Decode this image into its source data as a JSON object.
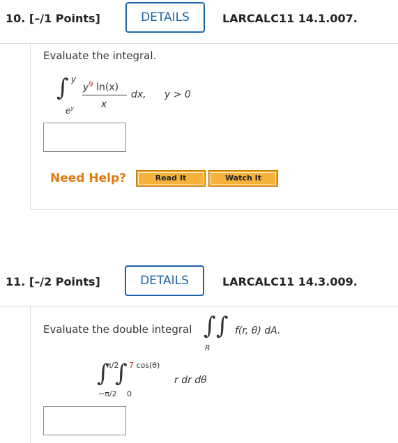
{
  "q10": {
    "number": "10.",
    "points": "[–/1 Points]",
    "details_label": "DETAILS",
    "code": "LARCALC11 14.1.007.",
    "prompt": "Evaluate the integral.",
    "integral": {
      "upper": "y",
      "lower": "e",
      "lower_sup": "y",
      "num_var": "y",
      "num_exp": "9",
      "num_rest": " ln(x)",
      "denominator": "x",
      "differential": "dx,",
      "condition": "y > 0"
    },
    "need_help": "Need Help?",
    "read_it": "Read It",
    "watch_it": "Watch It"
  },
  "q11": {
    "number": "11.",
    "points": "[–/2 Points]",
    "details_label": "DETAILS",
    "code": "LARCALC11 14.3.009.",
    "prompt": "Evaluate the double integral",
    "region": "R",
    "integrand": "f(r, θ) dA.",
    "outer_upper": "π/2",
    "outer_lower": "−π/2",
    "inner_upper_coef": "7",
    "inner_upper_rest": " cos(θ)",
    "inner_lower": "0",
    "body": "r dr dθ"
  }
}
